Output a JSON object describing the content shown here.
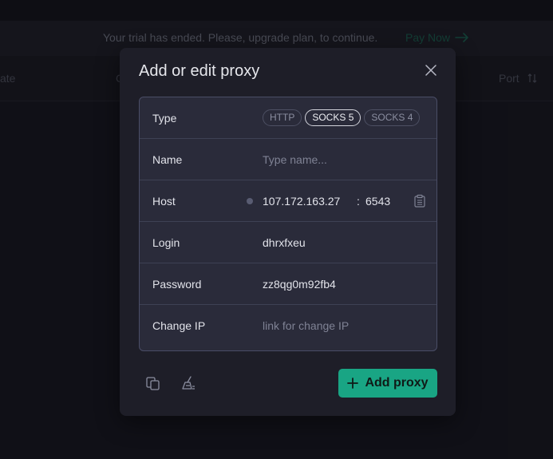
{
  "banner": {
    "message": "Your trial has ended. Please, upgrade plan, to continue.",
    "pay_label": "Pay Now"
  },
  "table_header": {
    "date": "ate",
    "c": "C",
    "port": "Port"
  },
  "modal": {
    "title": "Add or edit proxy",
    "type_label": "Type",
    "types": [
      "HTTP",
      "SOCKS 5",
      "SOCKS 4"
    ],
    "selected_type": "SOCKS 5",
    "name_label": "Name",
    "name_placeholder": "Type name...",
    "host_label": "Host",
    "host_ip": "107.172.163.27",
    "host_colon": ":",
    "host_port": "6543",
    "login_label": "Login",
    "login_value": "dhrxfxeu",
    "password_label": "Password",
    "password_value": "zz8qg0m92fb4",
    "change_ip_label": "Change IP",
    "change_ip_placeholder": "link for change IP",
    "add_button": "Add proxy"
  },
  "colors": {
    "accent": "#19a584",
    "background": "#15151c",
    "modal": "#1e1e28",
    "form": "#2a2b3a"
  },
  "icons": [
    "arrow-right-icon",
    "sort-icon",
    "close-icon",
    "clipboard-icon",
    "copy-icon",
    "clear-icon",
    "plus-icon"
  ]
}
